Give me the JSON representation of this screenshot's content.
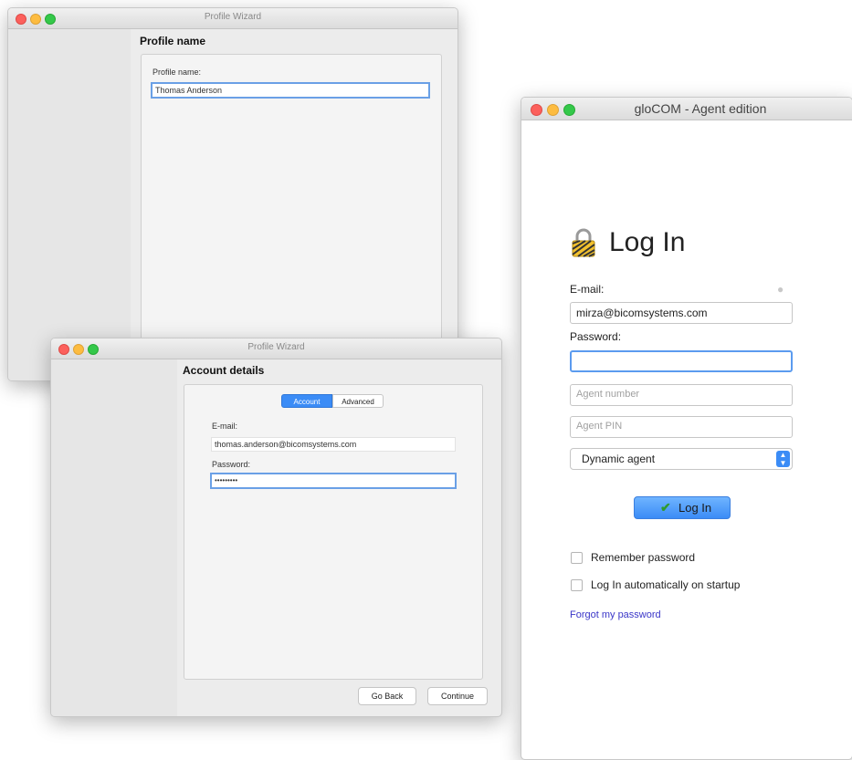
{
  "wizard_back": {
    "title": "Profile Wizard",
    "heading": "Profile name",
    "profile_name_label": "Profile name:",
    "profile_name_value": "Thomas Anderson"
  },
  "wizard_front": {
    "title": "Profile Wizard",
    "heading": "Account details",
    "tabs": [
      "Account",
      "Advanced"
    ],
    "email_label": "E-mail:",
    "email_value": "thomas.anderson@bicomsystems.com",
    "password_label": "Password:",
    "password_value": "•••••••••",
    "go_back": "Go Back",
    "continue": "Continue"
  },
  "glocom": {
    "title": "gloCOM - Agent edition",
    "heading": "Log In",
    "email_label": "E-mail:",
    "email_value": "mirza@bicomsystems.com",
    "password_label": "Password:",
    "password_value": "",
    "agent_number_placeholder": "Agent number",
    "agent_pin_placeholder": "Agent PIN",
    "agent_type": "Dynamic agent",
    "login_button": "Log In",
    "remember_password": "Remember password",
    "auto_login": "Log In automatically on startup",
    "forgot_password": "Forgot my password",
    "colors": {
      "accent": "#3b8cf6",
      "link": "#3a36c8",
      "check": "#3a9a3a"
    }
  }
}
